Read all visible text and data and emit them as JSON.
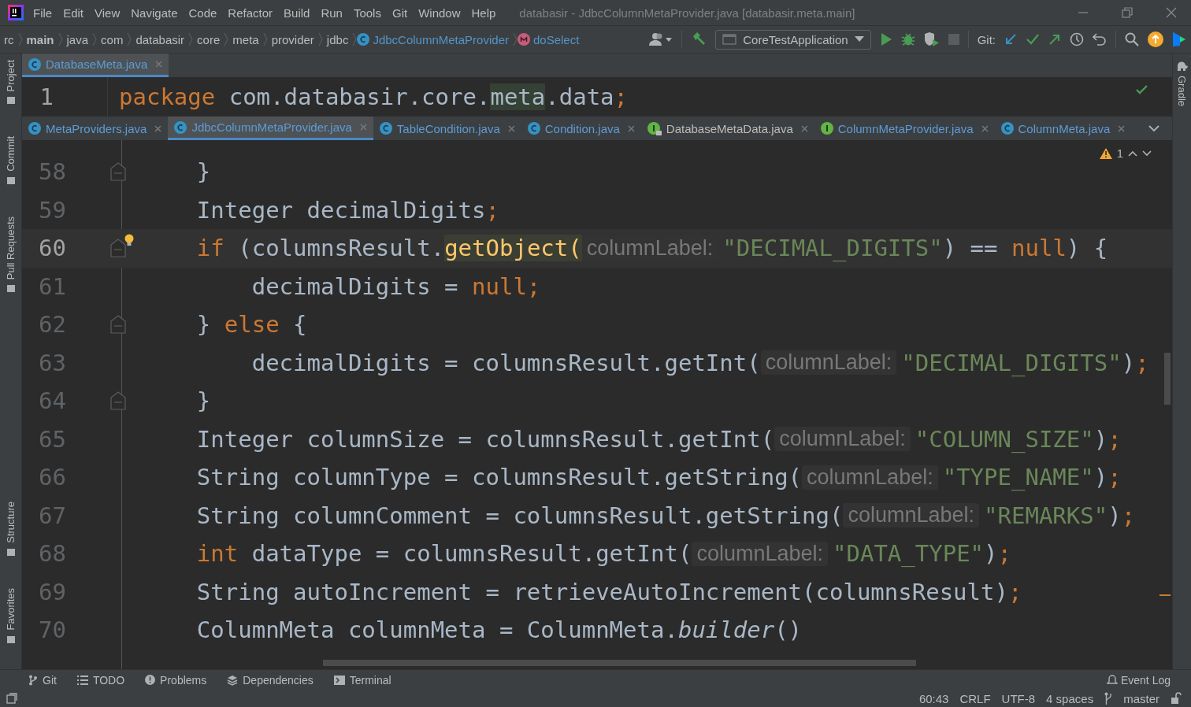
{
  "window": {
    "title": "databasir - JdbcColumnMetaProvider.java [databasir.meta.main]"
  },
  "menu": [
    "File",
    "Edit",
    "View",
    "Navigate",
    "Code",
    "Refactor",
    "Build",
    "Run",
    "Tools",
    "Git",
    "Window",
    "Help"
  ],
  "breadcrumbs": [
    {
      "label": "rc",
      "kind": "folder"
    },
    {
      "label": "main",
      "kind": "module"
    },
    {
      "label": "java",
      "kind": "folder"
    },
    {
      "label": "com",
      "kind": "folder"
    },
    {
      "label": "databasir",
      "kind": "folder"
    },
    {
      "label": "core",
      "kind": "folder"
    },
    {
      "label": "meta",
      "kind": "folder"
    },
    {
      "label": "provider",
      "kind": "folder"
    },
    {
      "label": "jdbc",
      "kind": "folder"
    },
    {
      "label": "JdbcColumnMetaProvider",
      "kind": "class"
    },
    {
      "label": "doSelect",
      "kind": "method"
    }
  ],
  "run_config": "CoreTestApplication",
  "git_label": "Git:",
  "left_tools": [
    "Project",
    "Commit",
    "Pull Requests",
    "Structure",
    "Favorites"
  ],
  "right_tools": [
    "Gradle"
  ],
  "top_tabs": [
    {
      "label": "DatabaseMeta.java",
      "kind": "class",
      "selected": true
    }
  ],
  "top_editor": {
    "line_number": "1",
    "segments": [
      {
        "kind": "kw",
        "text": "package"
      },
      {
        "kind": "plain",
        "text": " com.databasir.core."
      },
      {
        "kind": "mark",
        "text": "meta"
      },
      {
        "kind": "plain",
        "text": ".data"
      },
      {
        "kind": "kw",
        "text": ";"
      }
    ]
  },
  "tabs": [
    {
      "label": "MetaProviders.java",
      "kind": "class",
      "selected": false
    },
    {
      "label": "JdbcColumnMetaProvider.java",
      "kind": "class",
      "selected": true
    },
    {
      "label": "TableCondition.java",
      "kind": "class",
      "selected": false
    },
    {
      "label": "Condition.java",
      "kind": "class",
      "selected": false
    },
    {
      "label": "DatabaseMetaData.java",
      "kind": "locked-interface",
      "selected": false
    },
    {
      "label": "ColumnMetaProvider.java",
      "kind": "interface",
      "selected": false
    },
    {
      "label": "ColumnMeta.java",
      "kind": "class",
      "selected": false
    }
  ],
  "warning_count": "1",
  "lines": [
    {
      "number": "58",
      "selected": false,
      "fold_marker": true,
      "bulb": false,
      "segments": [
        {
          "kind": "plain",
          "text": "    }"
        }
      ]
    },
    {
      "number": "59",
      "selected": false,
      "fold_marker": false,
      "bulb": false,
      "segments": [
        {
          "kind": "plain",
          "text": "    Integer decimalDigits"
        },
        {
          "kind": "kw",
          "text": ";"
        }
      ]
    },
    {
      "number": "60",
      "selected": true,
      "fold_marker": true,
      "bulb": true,
      "segments": [
        {
          "kind": "kw",
          "text": "    if"
        },
        {
          "kind": "plain",
          "text": " (columnsResult."
        },
        {
          "kind": "mark",
          "text": "getObject("
        },
        {
          "kind": "hint",
          "text": "columnLabel:"
        },
        {
          "kind": "str",
          "text": "\"DECIMAL_DIGITS\""
        },
        {
          "kind": "plain",
          "text": ") == "
        },
        {
          "kind": "kw",
          "text": "null"
        },
        {
          "kind": "plain",
          "text": ") {"
        }
      ]
    },
    {
      "number": "61",
      "selected": false,
      "fold_marker": false,
      "bulb": false,
      "segments": [
        {
          "kind": "plain",
          "text": "        decimalDigits = "
        },
        {
          "kind": "kw",
          "text": "null;"
        }
      ]
    },
    {
      "number": "62",
      "selected": false,
      "fold_marker": true,
      "bulb": false,
      "segments": [
        {
          "kind": "plain",
          "text": "    } "
        },
        {
          "kind": "kw",
          "text": "else"
        },
        {
          "kind": "plain",
          "text": " {"
        }
      ]
    },
    {
      "number": "63",
      "selected": false,
      "fold_marker": false,
      "bulb": false,
      "segments": [
        {
          "kind": "plain",
          "text": "        decimalDigits = columnsResult.getInt("
        },
        {
          "kind": "hint",
          "text": "columnLabel:"
        },
        {
          "kind": "str",
          "text": "\"DECIMAL_DIGITS\""
        },
        {
          "kind": "plain",
          "text": ")"
        },
        {
          "kind": "kw",
          "text": ";"
        }
      ]
    },
    {
      "number": "64",
      "selected": false,
      "fold_marker": true,
      "bulb": false,
      "segments": [
        {
          "kind": "plain",
          "text": "    }"
        }
      ]
    },
    {
      "number": "65",
      "selected": false,
      "fold_marker": false,
      "bulb": false,
      "segments": [
        {
          "kind": "plain",
          "text": "    Integer columnSize = columnsResult.getInt("
        },
        {
          "kind": "hint",
          "text": "columnLabel:"
        },
        {
          "kind": "str",
          "text": "\"COLUMN_SIZE\""
        },
        {
          "kind": "plain",
          "text": ")"
        },
        {
          "kind": "kw",
          "text": ";"
        }
      ]
    },
    {
      "number": "66",
      "selected": false,
      "fold_marker": false,
      "bulb": false,
      "segments": [
        {
          "kind": "plain",
          "text": "    String columnType = columnsResult.getString("
        },
        {
          "kind": "hint",
          "text": "columnLabel:"
        },
        {
          "kind": "str",
          "text": "\"TYPE_NAME\""
        },
        {
          "kind": "plain",
          "text": ")"
        },
        {
          "kind": "kw",
          "text": ";"
        }
      ]
    },
    {
      "number": "67",
      "selected": false,
      "fold_marker": false,
      "bulb": false,
      "segments": [
        {
          "kind": "plain",
          "text": "    String columnComment = columnsResult.getString("
        },
        {
          "kind": "hint",
          "text": "columnLabel:"
        },
        {
          "kind": "str",
          "text": "\"REMARKS\""
        },
        {
          "kind": "plain",
          "text": ")"
        },
        {
          "kind": "kw",
          "text": ";"
        }
      ]
    },
    {
      "number": "68",
      "selected": false,
      "fold_marker": false,
      "bulb": false,
      "segments": [
        {
          "kind": "kw",
          "text": "    int"
        },
        {
          "kind": "plain",
          "text": " dataType = columnsResult.getInt("
        },
        {
          "kind": "hint",
          "text": "columnLabel:"
        },
        {
          "kind": "str",
          "text": "\"DATA_TYPE\""
        },
        {
          "kind": "plain",
          "text": ")"
        },
        {
          "kind": "kw",
          "text": ";"
        }
      ]
    },
    {
      "number": "69",
      "selected": false,
      "fold_marker": false,
      "bulb": false,
      "segments": [
        {
          "kind": "plain",
          "text": "    String autoIncrement = retrieveAutoIncrement(columnsResult)"
        },
        {
          "kind": "kw",
          "text": ";"
        }
      ]
    },
    {
      "number": "70",
      "selected": false,
      "fold_marker": false,
      "bulb": false,
      "segments": [
        {
          "kind": "plain",
          "text": "    ColumnMeta columnMeta = ColumnMeta."
        },
        {
          "kind": "italic",
          "text": "builder"
        },
        {
          "kind": "plain",
          "text": "()"
        }
      ]
    }
  ],
  "tool_windows": [
    "Git",
    "TODO",
    "Problems",
    "Dependencies",
    "Terminal"
  ],
  "event_log": "Event Log",
  "status": [
    "60:43",
    "CRLF",
    "UTF-8",
    "4 spaces",
    "master"
  ]
}
